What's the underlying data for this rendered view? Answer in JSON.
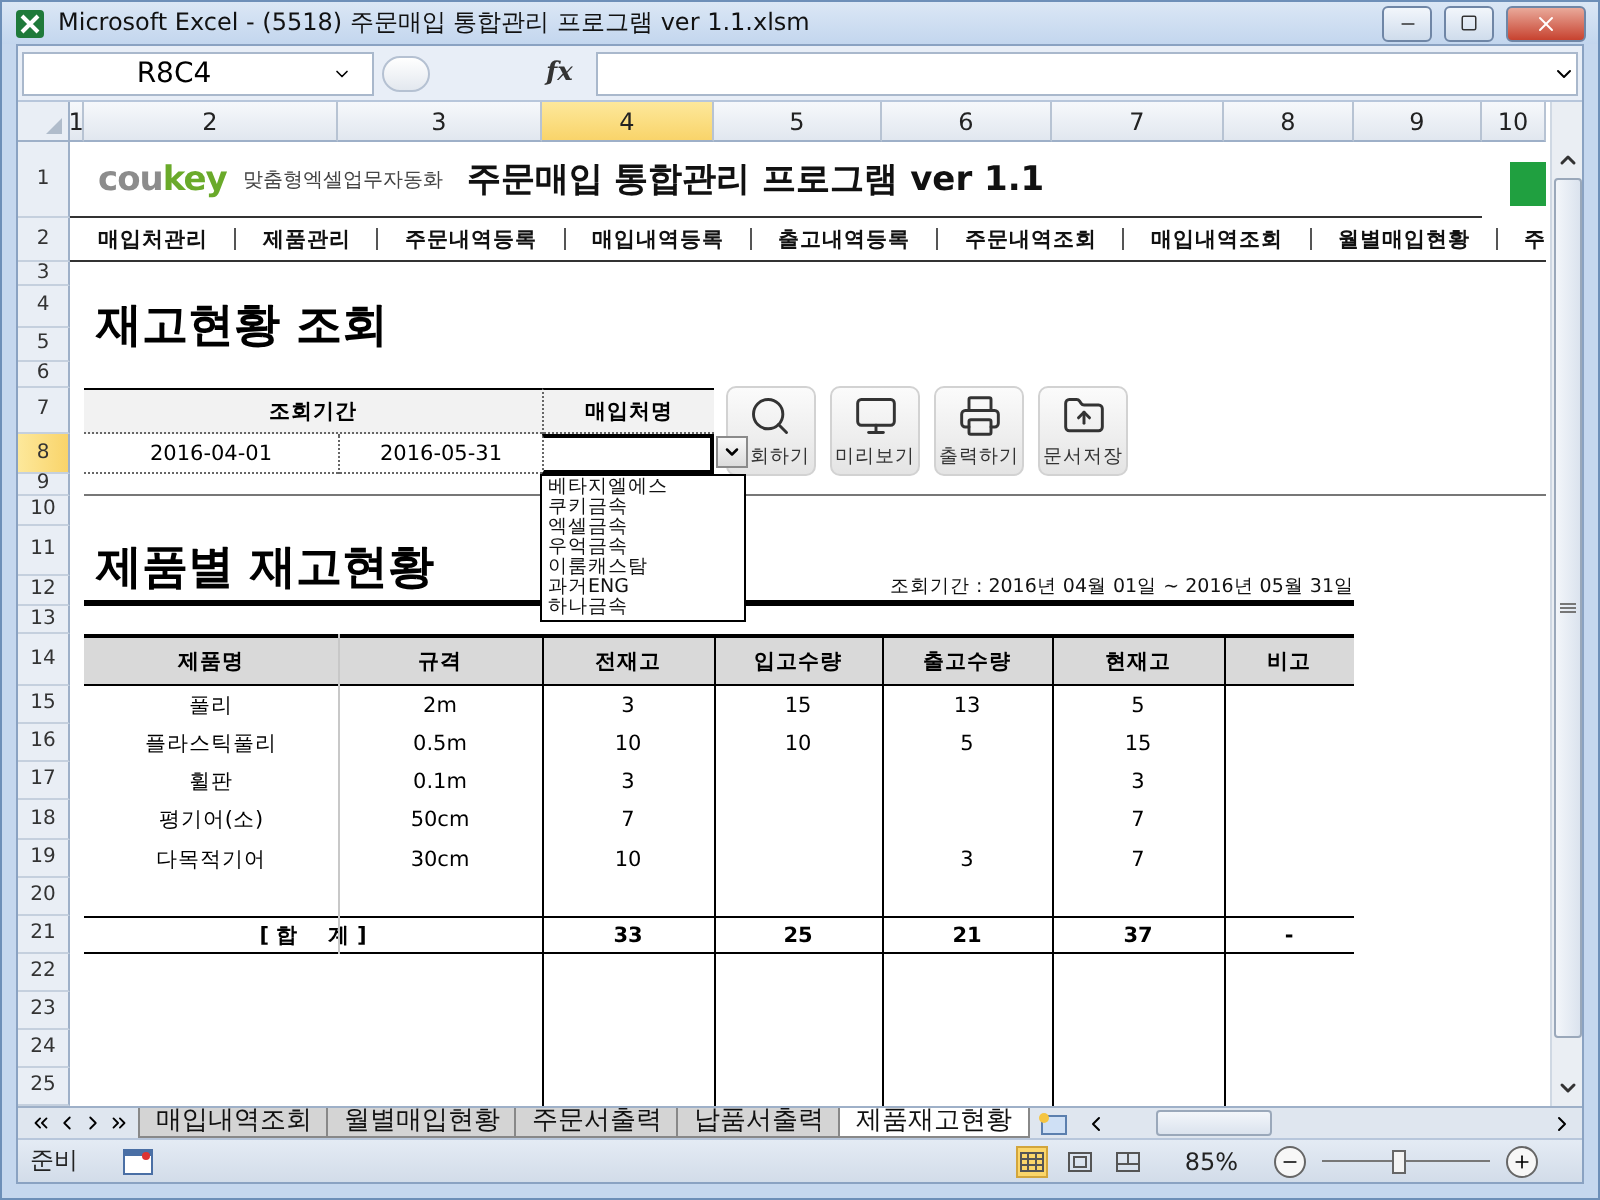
{
  "window": {
    "title": "Microsoft Excel - (5518) 주문매입 통합관리 프로그램 ver 1.1.xlsm"
  },
  "formula_bar": {
    "name_box": "R8C4",
    "function_label": "fx"
  },
  "column_headers": [
    {
      "label": "1",
      "selected": false
    },
    {
      "label": "2",
      "selected": false
    },
    {
      "label": "3",
      "selected": false
    },
    {
      "label": "4",
      "selected": true
    },
    {
      "label": "5",
      "selected": false
    },
    {
      "label": "6",
      "selected": false
    },
    {
      "label": "7",
      "selected": false
    },
    {
      "label": "8",
      "selected": false
    },
    {
      "label": "9",
      "selected": false
    },
    {
      "label": "10",
      "selected": false
    }
  ],
  "row_headers": [
    {
      "label": "1",
      "selected": false
    },
    {
      "label": "2",
      "selected": false
    },
    {
      "label": "3",
      "selected": false
    },
    {
      "label": "4",
      "selected": false
    },
    {
      "label": "5",
      "selected": false
    },
    {
      "label": "6",
      "selected": false
    },
    {
      "label": "7",
      "selected": false
    },
    {
      "label": "8",
      "selected": true
    },
    {
      "label": "9",
      "selected": false
    },
    {
      "label": "10",
      "selected": false
    },
    {
      "label": "11",
      "selected": false
    },
    {
      "label": "12",
      "selected": false
    },
    {
      "label": "13",
      "selected": false
    },
    {
      "label": "14",
      "selected": false
    },
    {
      "label": "15",
      "selected": false
    },
    {
      "label": "16",
      "selected": false
    },
    {
      "label": "17",
      "selected": false
    },
    {
      "label": "18",
      "selected": false
    },
    {
      "label": "19",
      "selected": false
    },
    {
      "label": "20",
      "selected": false
    },
    {
      "label": "21",
      "selected": false
    },
    {
      "label": "22",
      "selected": false
    },
    {
      "label": "23",
      "selected": false
    },
    {
      "label": "24",
      "selected": false
    },
    {
      "label": "25",
      "selected": false
    }
  ],
  "brand": {
    "logo": [
      {
        "text": "cou",
        "color": "#8c8c8c"
      },
      {
        "text": "key",
        "color": "#6aaa2a"
      }
    ],
    "tagline": "맞춤형엑셀업무자동화"
  },
  "program_title": "주문매입 통합관리 프로그램 ver 1.1",
  "menu": [
    "매입처관리",
    "제품관리",
    "주문내역등록",
    "매입내역등록",
    "출고내역등록",
    "주문내역조회",
    "매입내역조회",
    "월별매입현황",
    "주"
  ],
  "section1_title": "재고현황 조회",
  "search_form": {
    "period_label": "조회기간",
    "start": "2016-04-01",
    "end": "2016-05-31",
    "supplier_label": "매입처명"
  },
  "dropdown": {
    "expanded": true,
    "options": [
      "베타지엘에스",
      "쿠키금속",
      "엑셀금속",
      "우억금속",
      "이룸캐스탐",
      "과거ENG",
      "하나금속"
    ]
  },
  "buttons": [
    {
      "label": "회하기",
      "kind": "search"
    },
    {
      "label": "미리보기",
      "kind": "preview"
    },
    {
      "label": "출력하기",
      "kind": "print"
    },
    {
      "label": "문서저장",
      "kind": "save"
    }
  ],
  "section2_title": "제품별 재고현황",
  "period_note": "조회기간 : 2016년 04월 01일 ~ 2016년 05월 31일",
  "table": {
    "columns": [
      "제품명",
      "규격",
      "전재고",
      "입고수량",
      "출고수량",
      "현재고",
      "비고"
    ],
    "rows": [
      [
        "풀리",
        "2m",
        "3",
        "15",
        "13",
        "5",
        null
      ],
      [
        "플라스틱풀리",
        "0.5m",
        "10",
        "10",
        "5",
        "15",
        null
      ],
      [
        "휠판",
        "0.1m",
        "3",
        null,
        null,
        "3",
        null
      ],
      [
        "평기어(소)",
        "50cm",
        "7",
        null,
        null,
        "7",
        null
      ],
      [
        "다목적기어",
        "30cm",
        "10",
        null,
        "3",
        "7",
        null
      ]
    ],
    "total": {
      "label": "[ 합    계 ]",
      "values": [
        "33",
        "25",
        "21",
        "37",
        "-"
      ]
    }
  },
  "sheet_tabs": [
    {
      "label": "매입내역조회",
      "selected": false
    },
    {
      "label": "월별매입현황",
      "selected": false
    },
    {
      "label": "주문서출력",
      "selected": false
    },
    {
      "label": "납품서출력",
      "selected": false
    },
    {
      "label": "제품재고현황",
      "selected": true
    }
  ],
  "status_bar": {
    "mode": "준비",
    "zoom": "85%",
    "zoom_slider": {
      "level": 0.45
    }
  }
}
